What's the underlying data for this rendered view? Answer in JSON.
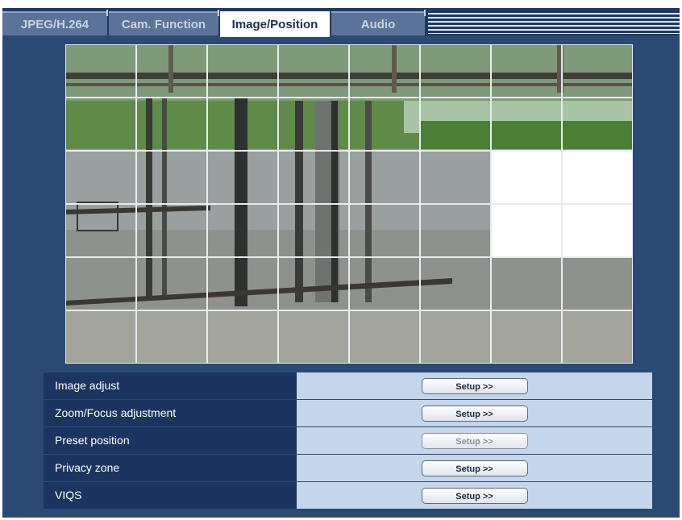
{
  "tabs": [
    {
      "label": "JPEG/H.264",
      "active": false
    },
    {
      "label": "Cam. Function",
      "active": false
    },
    {
      "label": "Image/Position",
      "active": true
    },
    {
      "label": "Audio",
      "active": false
    }
  ],
  "privacy_grid": {
    "columns": 8,
    "rows": 6,
    "masked_cells": [
      [
        2,
        6
      ],
      [
        2,
        7
      ],
      [
        3,
        6
      ],
      [
        3,
        7
      ]
    ]
  },
  "settings": [
    {
      "label": "Image adjust",
      "button": "Setup >>",
      "enabled": true
    },
    {
      "label": "Zoom/Focus adjustment",
      "button": "Setup >>",
      "enabled": true
    },
    {
      "label": "Preset position",
      "button": "Setup >>",
      "enabled": false
    },
    {
      "label": "Privacy zone",
      "button": "Setup >>",
      "enabled": true
    },
    {
      "label": "VIQS",
      "button": "Setup >>",
      "enabled": true
    }
  ]
}
